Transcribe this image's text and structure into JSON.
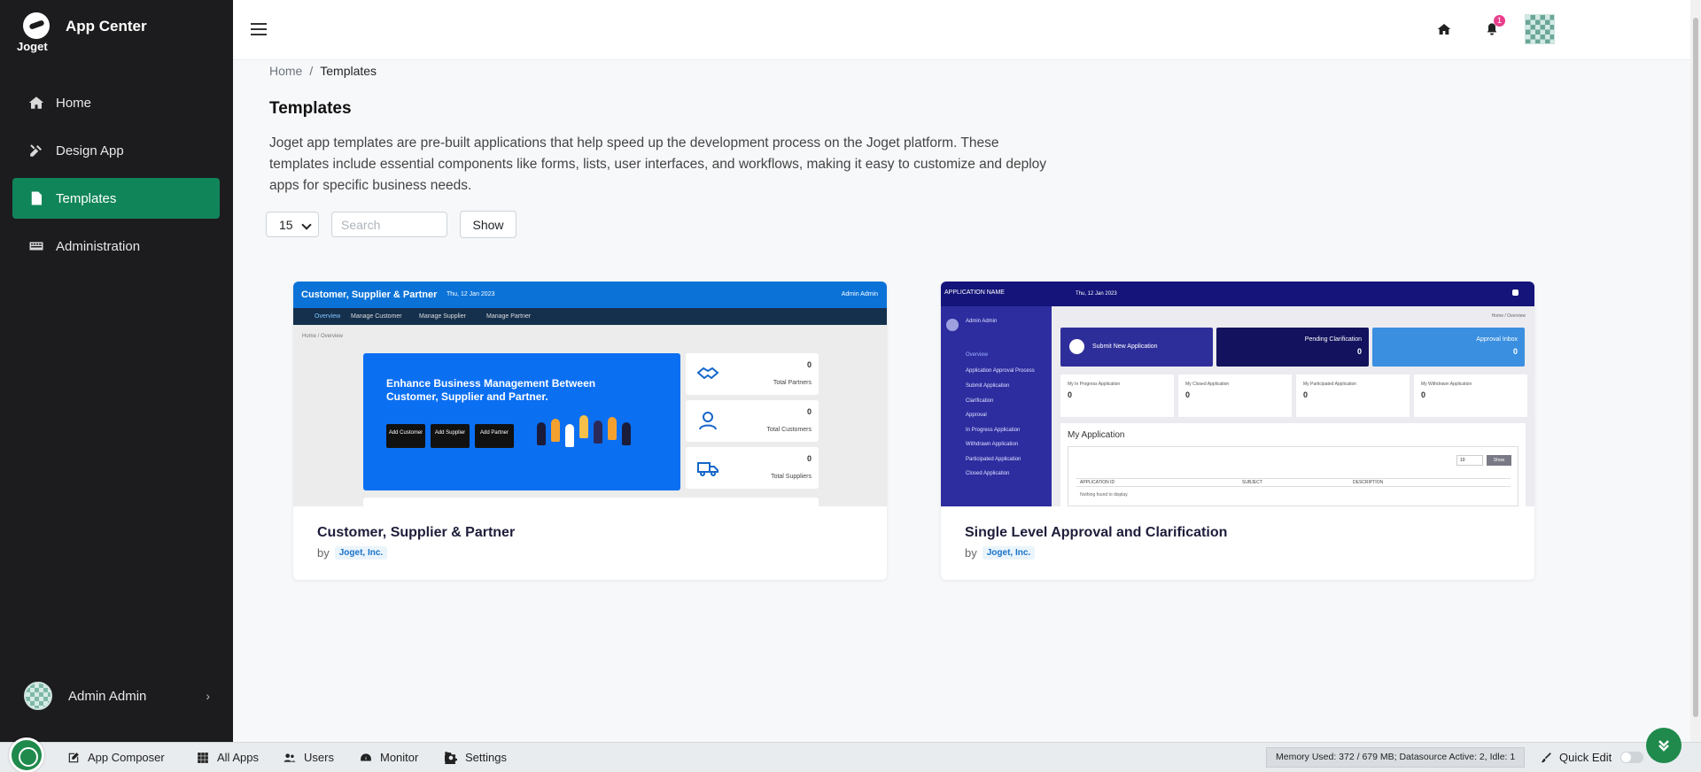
{
  "app": {
    "title": "App Center",
    "logo_text": "Joget"
  },
  "sidebar": {
    "items": [
      {
        "label": "Home",
        "icon": "home-icon"
      },
      {
        "label": "Design App",
        "icon": "tools-icon"
      },
      {
        "label": "Templates",
        "icon": "file-icon",
        "active": true
      },
      {
        "label": "Administration",
        "icon": "keyboard-icon"
      }
    ],
    "user": {
      "name": "Admin Admin"
    }
  },
  "topbar": {
    "notification_count": "1"
  },
  "breadcrumb": {
    "home": "Home",
    "separator": "/",
    "current": "Templates"
  },
  "page": {
    "title": "Templates",
    "description": "Joget app templates are pre-built applications that help speed up the development process on the Joget platform. These templates include essential components like forms, lists, user interfaces, and workflows, making it easy to customize and deploy apps for specific business needs."
  },
  "filters": {
    "page_size": "15",
    "search_placeholder": "Search",
    "show_label": "Show"
  },
  "cards": [
    {
      "title": "Customer, Supplier & Partner",
      "by": "by",
      "author": "Joget, Inc.",
      "preview": {
        "header": "Customer, Supplier & Partner",
        "date": "Thu, 12 Jan 2023",
        "user": "Admin Admin",
        "tabs": [
          "Overview",
          "Manage Customer",
          "Manage Supplier",
          "Manage Partner"
        ],
        "crumb": "Home / Overview",
        "hero": "Enhance Business Management Between Customer, Supplier and Partner.",
        "buttons": [
          "Add Customer",
          "Add Supplier",
          "Add Partner"
        ],
        "stats": [
          {
            "value": "0",
            "label": "Total Partners"
          },
          {
            "value": "0",
            "label": "Total Customers"
          },
          {
            "value": "0",
            "label": "Total Suppliers"
          }
        ]
      }
    },
    {
      "title": "Single Level Approval and Clarification",
      "by": "by",
      "author": "Joget, Inc.",
      "preview": {
        "header": "APPLICATION NAME",
        "date": "Thu, 12 Jan 2023",
        "user": "Admin Admin",
        "crumb": "Home / Overview",
        "menu": [
          "Overview",
          "Application Approval Process",
          "Submit Application",
          "Clarification",
          "Approval",
          "In Progress Application",
          "Withdrawn Application",
          "Participated Application",
          "Closed Application"
        ],
        "boxes": [
          {
            "label": "Submit New Application",
            "value": "",
            "color": "#2e2e9a"
          },
          {
            "label": "Pending Clarification",
            "value": "0",
            "color": "#12125e"
          },
          {
            "label": "Approval Inbox",
            "value": "0",
            "color": "#3a8fe0"
          }
        ],
        "stats": [
          {
            "label": "My In Progress Application",
            "value": "0"
          },
          {
            "label": "My Closed Application",
            "value": "0"
          },
          {
            "label": "My Participated Application",
            "value": "0"
          },
          {
            "label": "My Withdrawn Application",
            "value": "0"
          }
        ],
        "list_title": "My Application",
        "list_page_size": "10",
        "list_show": "Show",
        "columns": [
          "APPLICATION ID",
          "SUBJECT",
          "DESCRIPTION"
        ],
        "empty": "Nothing found to display."
      }
    }
  ],
  "bottombar": {
    "items": [
      {
        "label": "App Composer",
        "icon": "edit-icon"
      },
      {
        "label": "All Apps",
        "icon": "grid-icon"
      },
      {
        "label": "Users",
        "icon": "users-icon"
      },
      {
        "label": "Monitor",
        "icon": "gauge-icon"
      },
      {
        "label": "Settings",
        "icon": "gears-icon"
      }
    ],
    "memory": "Memory Used: 372 / 679 MB; Datasource Active: 2, Idle: 1",
    "quick_edit": "Quick Edit"
  },
  "colors": {
    "sidebar_bg": "#1c1c1e",
    "active": "#11855a",
    "brand_green": "#1f8a4c",
    "notif": "#e83e8c"
  }
}
